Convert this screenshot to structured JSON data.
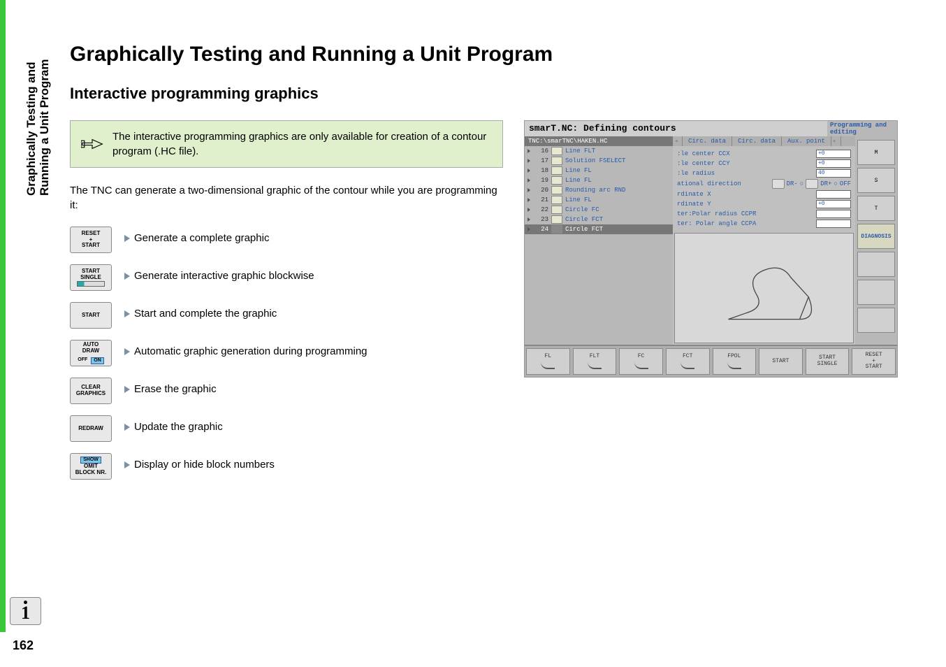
{
  "sidebar": {
    "title_line1": "Graphically Testing and",
    "title_line2": "Running a Unit Program"
  },
  "headings": {
    "title": "Graphically Testing and Running a Unit Program",
    "subtitle": "Interactive programming graphics"
  },
  "note": {
    "text": "The interactive programming graphics are only available for creation of a contour program (.HC file)."
  },
  "body1": "The TNC can generate a two-dimensional graphic of the contour while you are programming it:",
  "actions": [
    {
      "btn": {
        "line1": "RESET",
        "line2": "+",
        "line3": "START"
      },
      "text": "Generate a complete graphic"
    },
    {
      "btn": {
        "line1": "START",
        "line2": "SINGLE"
      },
      "single_bar": true,
      "text": "Generate interactive graphic blockwise"
    },
    {
      "btn": {
        "line1": "START"
      },
      "text": "Start and complete the graphic"
    },
    {
      "btn": {
        "line1": "AUTO",
        "line2": "DRAW",
        "off": "OFF",
        "on": "ON"
      },
      "autodraw": true,
      "text": "Automatic graphic generation during programming"
    },
    {
      "btn": {
        "line1": "CLEAR",
        "line2": "GRAPHICS"
      },
      "text": "Erase the graphic"
    },
    {
      "btn": {
        "line1": "REDRAW"
      },
      "text": "Update the graphic"
    },
    {
      "btn": {
        "line1": "SHOW",
        "line2": "OMIT",
        "line3": "BLOCK NR."
      },
      "show": true,
      "text": "Display or hide block numbers"
    }
  ],
  "screenshot": {
    "title": "smarT.NC: Defining contours",
    "mode": "Programming and editing",
    "filepath": "TNC:\\smarTNC\\HAKEN.HC",
    "program": [
      {
        "num": "16",
        "marker": "▸",
        "text": "Line FLT"
      },
      {
        "num": "17",
        "marker": "",
        "text": "Solution FSELECT"
      },
      {
        "num": "18",
        "marker": "▸",
        "text": "Line FL"
      },
      {
        "num": "19",
        "marker": "▸",
        "text": "Line FL"
      },
      {
        "num": "20",
        "marker": "",
        "text": "Rounding arc RND"
      },
      {
        "num": "21",
        "marker": "▸",
        "text": "Line FL"
      },
      {
        "num": "22",
        "marker": "▸",
        "text": "Circle FC"
      },
      {
        "num": "23",
        "marker": "▸",
        "text": "Circle FCT"
      },
      {
        "num": "24",
        "marker": "*",
        "text": "Circle FCT",
        "selected": true
      }
    ],
    "tabs": {
      "t1": "Circ. data",
      "t2": "Circ. data",
      "t3": "Aux. point"
    },
    "form": [
      {
        "label": ":le center CCX",
        "value": "+0"
      },
      {
        "label": ":le center CCY",
        "value": "+0"
      },
      {
        "label": ":le radius",
        "value": "40"
      },
      {
        "label": "ational direction",
        "radios": true,
        "r1": "DR-",
        "r2": "DR+",
        "r3": "OFF"
      },
      {
        "label": "rdinate X",
        "value": ""
      },
      {
        "label": "rdinate Y",
        "value": "+0"
      },
      {
        "label": "ter:Polar radius CCPR",
        "value": ""
      },
      {
        "label": "ter: Polar angle CCPA",
        "value": ""
      }
    ],
    "rightbuttons": [
      {
        "label": "M",
        "sub": ""
      },
      {
        "label": "S",
        "sub": ""
      },
      {
        "label": "T",
        "sub": ""
      },
      {
        "label": "DIAGNOSIS",
        "diag": true
      },
      {
        "label": "",
        "blank": true
      },
      {
        "label": "",
        "blank": true
      },
      {
        "label": "",
        "blank": true
      }
    ],
    "softkeys": [
      {
        "label": "FL"
      },
      {
        "label": "FLT"
      },
      {
        "label": "FC"
      },
      {
        "label": "FCT"
      },
      {
        "label": "FPOL"
      },
      {
        "label": "START"
      },
      {
        "label": "START\nSINGLE"
      },
      {
        "label": "RESET\n+\nSTART"
      }
    ]
  },
  "page_number": "162"
}
